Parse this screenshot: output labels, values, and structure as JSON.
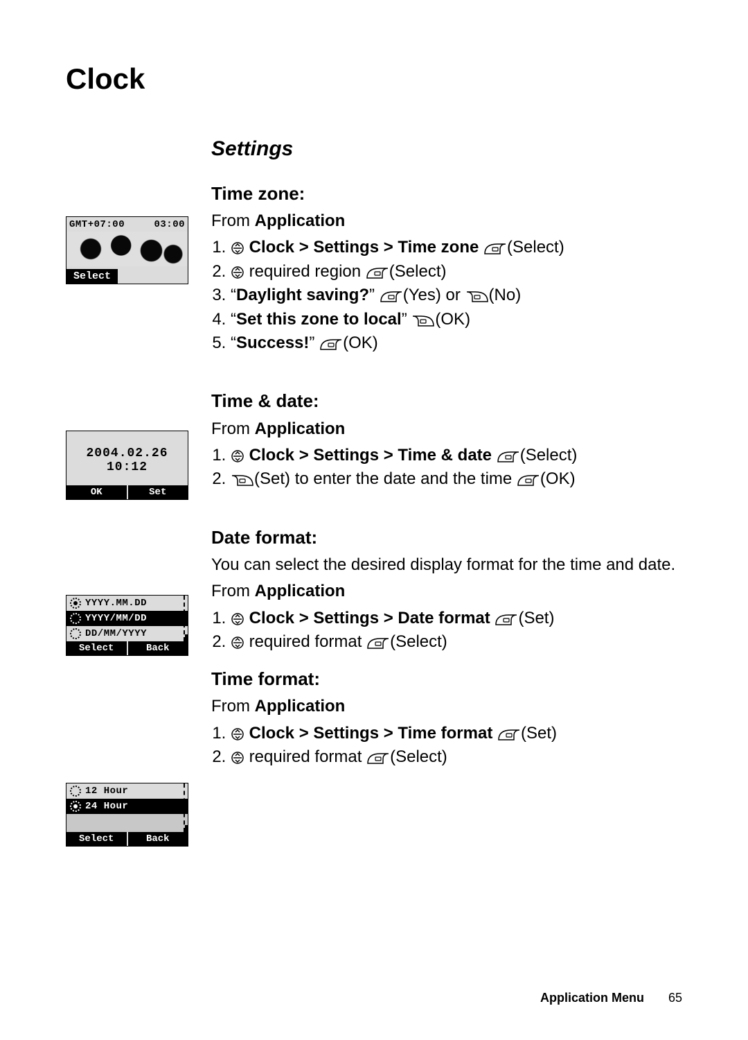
{
  "page": {
    "title": "Clock",
    "section": "Settings",
    "footer_label": "Application Menu",
    "footer_page": "65"
  },
  "labels": {
    "from": "From",
    "application": "Application",
    "select": "Select",
    "set": "Set",
    "ok": "OK",
    "back": "Back",
    "yes": "Yes",
    "no": "No"
  },
  "timezone": {
    "heading": "Time zone:",
    "step1_bold": "Clock > Settings > Time zone",
    "step2": "required region",
    "step3_prompt": "Daylight saving?",
    "step4_prompt": "Set this zone to local",
    "step5_prompt": "Success!",
    "screen": {
      "gmt": "GMT+07:00",
      "time": "03:00",
      "softkey": "Select"
    }
  },
  "timedate": {
    "heading": "Time & date:",
    "step1_bold": "Clock > Settings > Time & date",
    "step2_tail": "to enter the date and the time",
    "screen": {
      "date": "2004.02.26",
      "time": "10:12",
      "sk_left": "OK",
      "sk_right": "Set"
    }
  },
  "dateformat": {
    "heading": "Date format:",
    "intro": "You can select the desired display format for the time and date.",
    "step1_bold": "Clock > Settings > Date format",
    "step2": "required format",
    "screen": {
      "options": [
        "YYYY.MM.DD",
        "YYYY/MM/DD",
        "DD/MM/YYYY"
      ],
      "selected_index": 1,
      "sk_left": "Select",
      "sk_right": "Back"
    }
  },
  "timeformat": {
    "heading": "Time format:",
    "step1_bold": "Clock > Settings > Time format",
    "step2": "required format",
    "screen": {
      "options": [
        "12 Hour",
        "24 Hour"
      ],
      "selected_index": 1,
      "sk_left": "Select",
      "sk_right": "Back"
    }
  }
}
